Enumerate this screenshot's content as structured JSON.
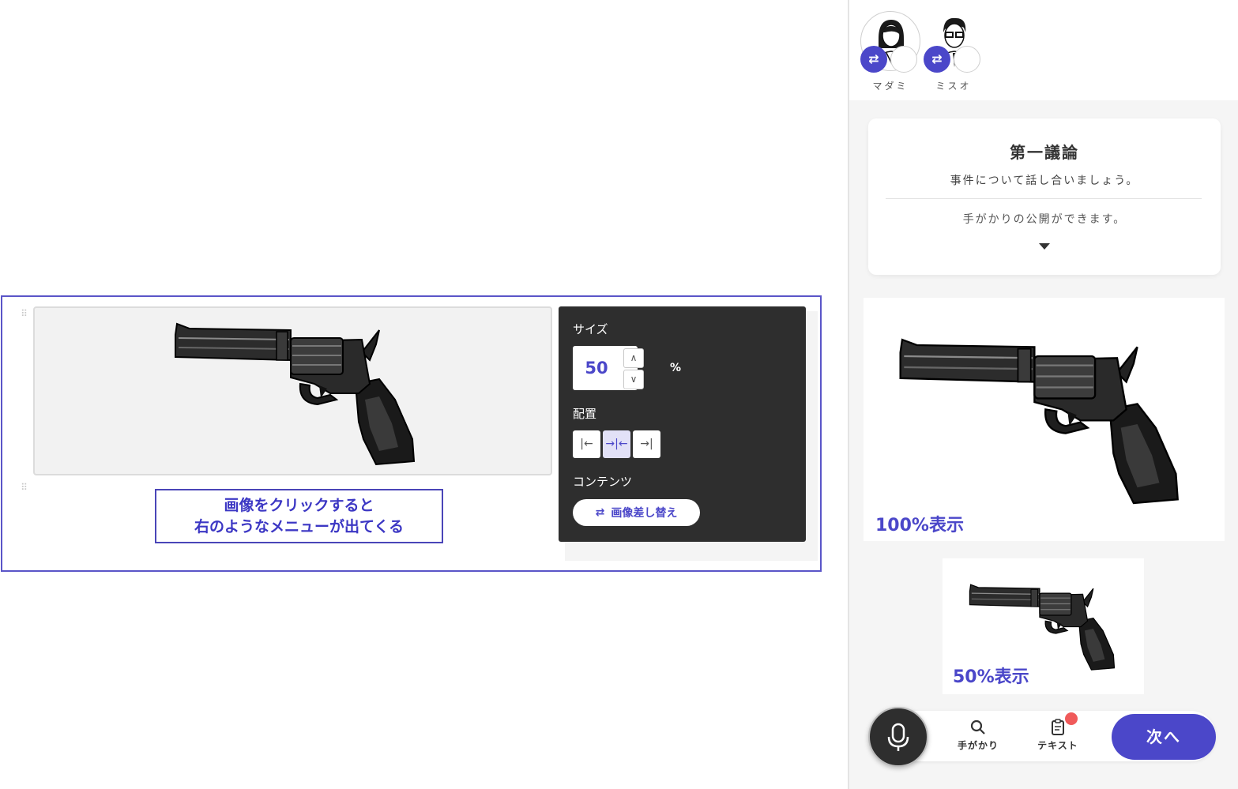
{
  "annotation": {
    "callout_line1": "画像をクリックすると",
    "callout_line2": "右のようなメニューが出てくる"
  },
  "image_settings": {
    "size_label": "サイズ",
    "size_value": "50",
    "size_unit": "%",
    "align_label": "配置",
    "align_options": [
      "left",
      "center",
      "right"
    ],
    "align_selected": "center",
    "content_label": "コンテンツ",
    "replace_button": "画像差し替え"
  },
  "players": [
    {
      "name": "マダミ",
      "icon": "woman-avatar-icon"
    },
    {
      "name": "ミスオ",
      "icon": "man-glasses-avatar-icon"
    }
  ],
  "phase": {
    "title": "第一議論",
    "subtitle": "事件について話し合いましょう。",
    "note": "手がかりの公開ができます。"
  },
  "previews": {
    "label_100": "100%表示",
    "label_50": "50%表示"
  },
  "bottom_nav": {
    "clues_label": "手がかり",
    "text_label": "テキスト",
    "next_label": "次へ"
  },
  "colors": {
    "accent": "#4b47c9",
    "panel_dark": "#2e2e2e",
    "notification": "#f05a5a"
  }
}
